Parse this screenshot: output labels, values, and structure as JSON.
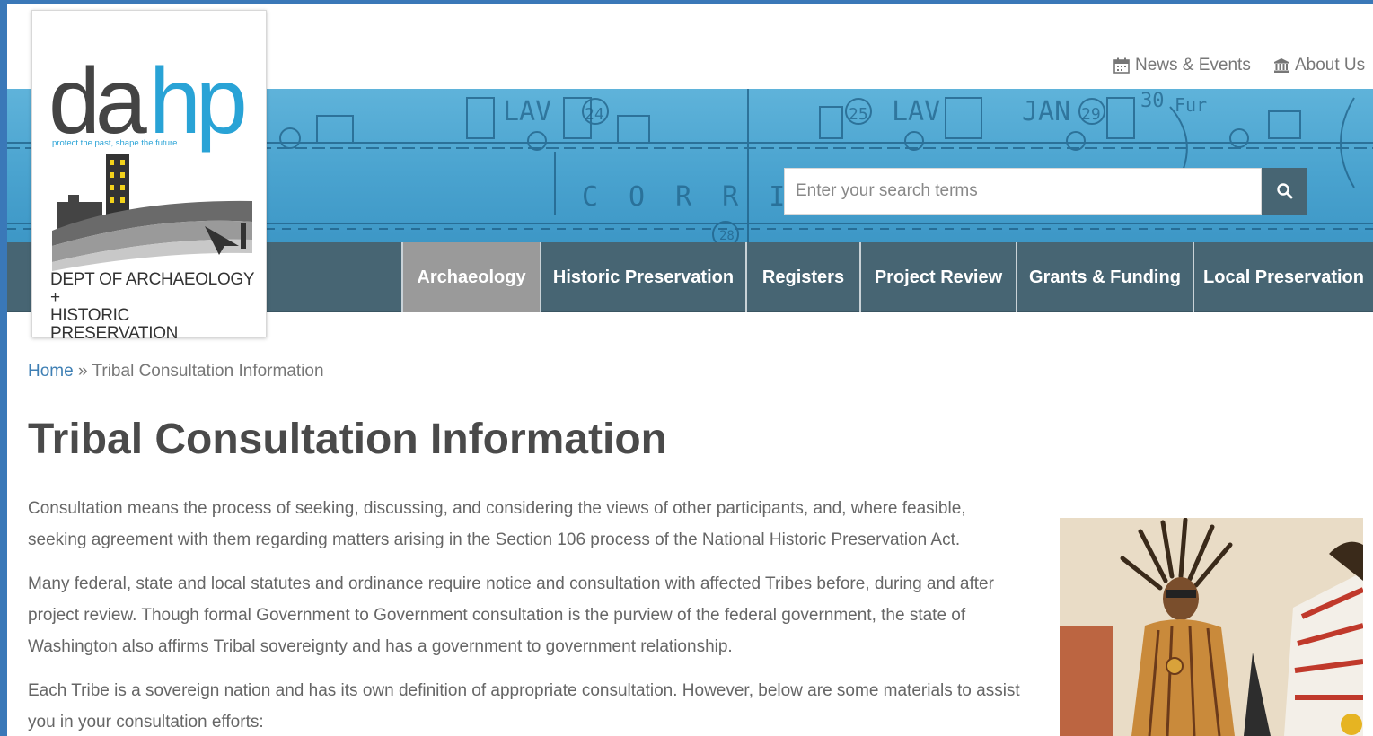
{
  "header": {
    "news_events": "News & Events",
    "about_us": "About Us"
  },
  "logo": {
    "wordmark": "dahp",
    "tagline": "protect the past, shape the future",
    "dept_line1": "DEPT OF ARCHAEOLOGY +",
    "dept_line2": "HISTORIC PRESERVATION"
  },
  "search": {
    "placeholder": "Enter your search terms"
  },
  "nav": {
    "items": [
      {
        "label": "Archaeology",
        "active": true
      },
      {
        "label": "Historic Preservation",
        "active": false
      },
      {
        "label": "Registers",
        "active": false
      },
      {
        "label": "Project Review",
        "active": false
      },
      {
        "label": "Grants & Funding",
        "active": false
      },
      {
        "label": "Local Preservation",
        "active": false
      }
    ]
  },
  "breadcrumb": {
    "home": "Home",
    "separator": "»",
    "current": "Tribal Consultation Information"
  },
  "page": {
    "title": "Tribal Consultation Information",
    "paragraphs": [
      "Consultation means the process of seeking, discussing, and considering the views of other participants, and, where feasible, seeking agreement with them regarding matters arising in the Section 106 process of the National Historic Preservation Act.",
      "Many federal, state and local statutes and ordinance require notice and consultation with affected Tribes before, during and after project review.  Though formal Government to Government consultation is the purview of the federal government, the state of Washington also affirms Tribal sovereignty and has a government to government relationship.",
      "Each Tribe is a sovereign nation and has its own definition of appropriate consultation.  However, below are some materials to assist you in your consultation efforts:"
    ]
  },
  "colors": {
    "frame": "#3a78b8",
    "nav_bg": "#476573",
    "nav_active": "#9a9a9a",
    "link": "#3e7fb4",
    "logo_blue": "#29a3d6"
  },
  "banner": {
    "blueprint_marks": [
      "LAV",
      "24",
      "25",
      "LAV",
      "JAN",
      "29",
      "30",
      "Fur",
      "CORRID",
      "28"
    ]
  }
}
